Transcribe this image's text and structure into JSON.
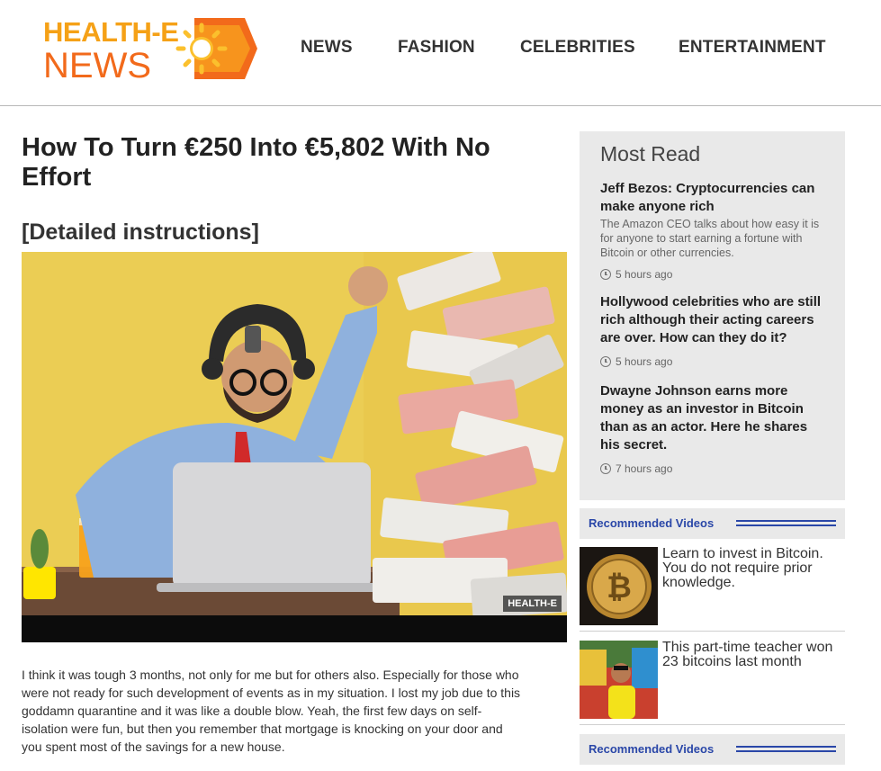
{
  "site": {
    "logo_line1": "HEALTH-E",
    "logo_line2": "NEWS",
    "brand_colors": {
      "primary_orange": "#f26a1b",
      "light_orange": "#f5a117",
      "link_blue": "#2a47a8"
    }
  },
  "nav": {
    "items": [
      "NEWS",
      "FASHION",
      "CELEBRITIES",
      "ENTERTAINMENT"
    ]
  },
  "article": {
    "title": "How To Turn €250 Into €5,802 With No Effort",
    "subtitle": "[Detailed instructions]",
    "hero_badge": "HEALTH-E",
    "body": "I think it was tough 3 months, not only for me but for others also. Especially for those who were not ready for such development of events as in my situation. I lost my job due to this goddamn quarantine and it was like a double blow. Yeah, the first few days on self-isolation were fun, but then you remember that mortgage is knocking on your door and you spent most of the savings for a new house."
  },
  "most_read": {
    "title": "Most Read",
    "items": [
      {
        "headline": "Jeff Bezos: Cryptocurrencies can make anyone rich",
        "description": "The Amazon CEO talks about how easy it is for anyone to start earning a fortune with Bitcoin or other currencies.",
        "time": "5 hours ago"
      },
      {
        "headline": "Hollywood celebrities who are still rich although their acting careers are over. How can they do it?",
        "description": "",
        "time": "5 hours ago"
      },
      {
        "headline": "Dwayne Johnson earns more money as an investor in Bitcoin than as an actor. Here he shares his secret.",
        "description": "",
        "time": "7 hours ago"
      }
    ]
  },
  "recommended": {
    "title": "Recommended Videos",
    "videos": [
      {
        "text": "Learn to invest in Bitcoin. You do not require prior knowledge."
      },
      {
        "text": "This part-time teacher won 23 bitcoins last month"
      }
    ]
  }
}
